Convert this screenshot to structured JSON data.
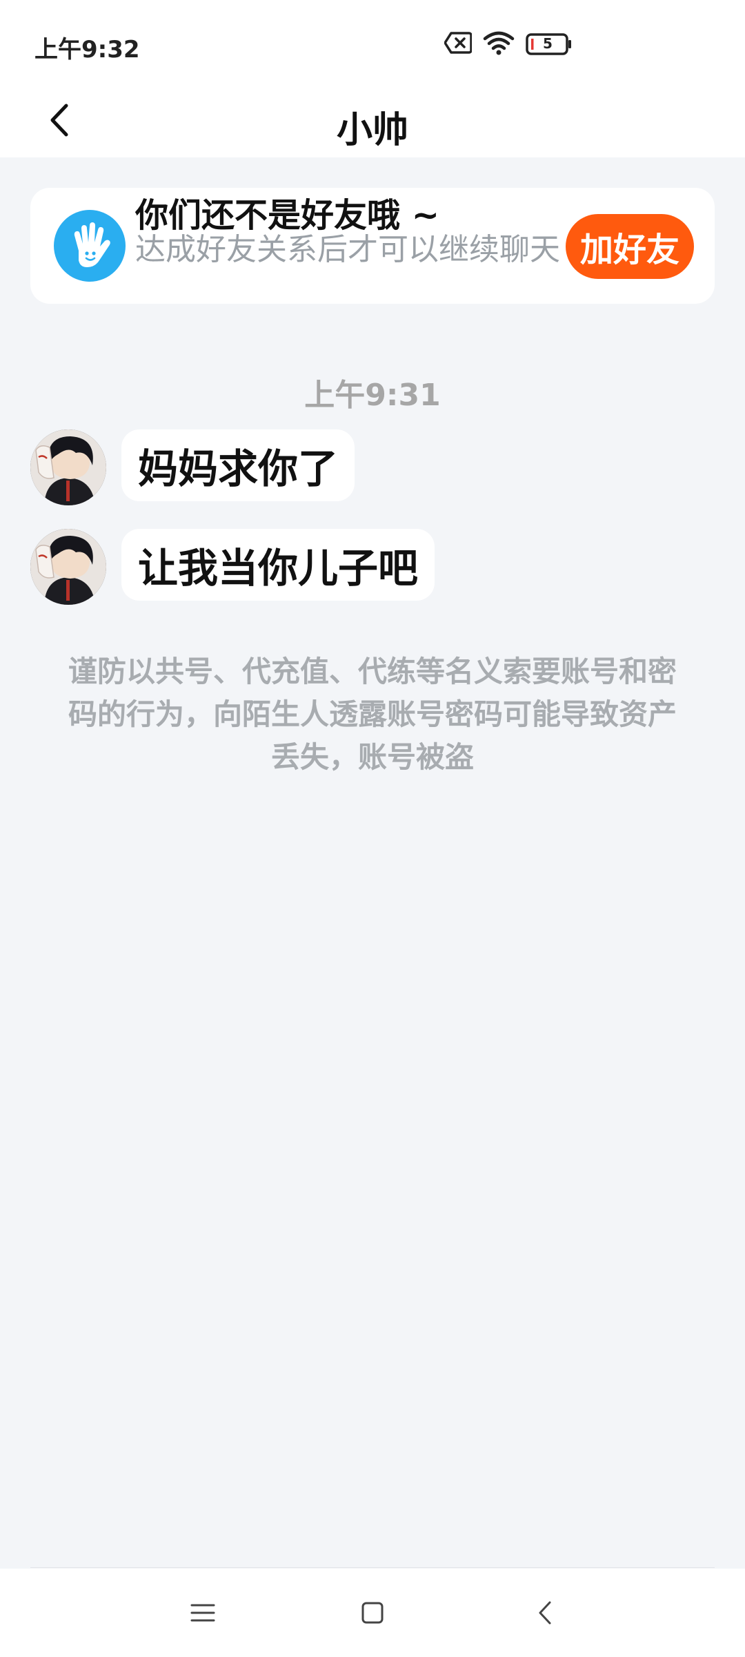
{
  "status_bar": {
    "time": "上午9:32",
    "battery_level": "5",
    "icons": [
      "no-sim-icon",
      "wifi-icon",
      "battery-icon"
    ]
  },
  "nav": {
    "title": "小帅",
    "back_icon": "chevron-left-icon"
  },
  "friend_card": {
    "title": "你们还不是好友哦 ~",
    "subtitle": "达成好友关系后才可以继续聊天",
    "add_button": "加好友",
    "icon": "hand-icon",
    "accent": "#ff5a0e",
    "icon_color": "#2aaef0"
  },
  "chat": {
    "timestamp": "上午9:31",
    "messages": [
      {
        "text": "妈妈求你了"
      },
      {
        "text": "让我当你儿子吧"
      }
    ],
    "warning": "谨防以共号、代充值、代练等名义索要账号和密码的行为，向陌生人透露账号密码可能导致资产丢失，账号被盗"
  },
  "system_nav": {
    "icons": [
      "menu-icon",
      "home-icon",
      "back-icon"
    ]
  }
}
